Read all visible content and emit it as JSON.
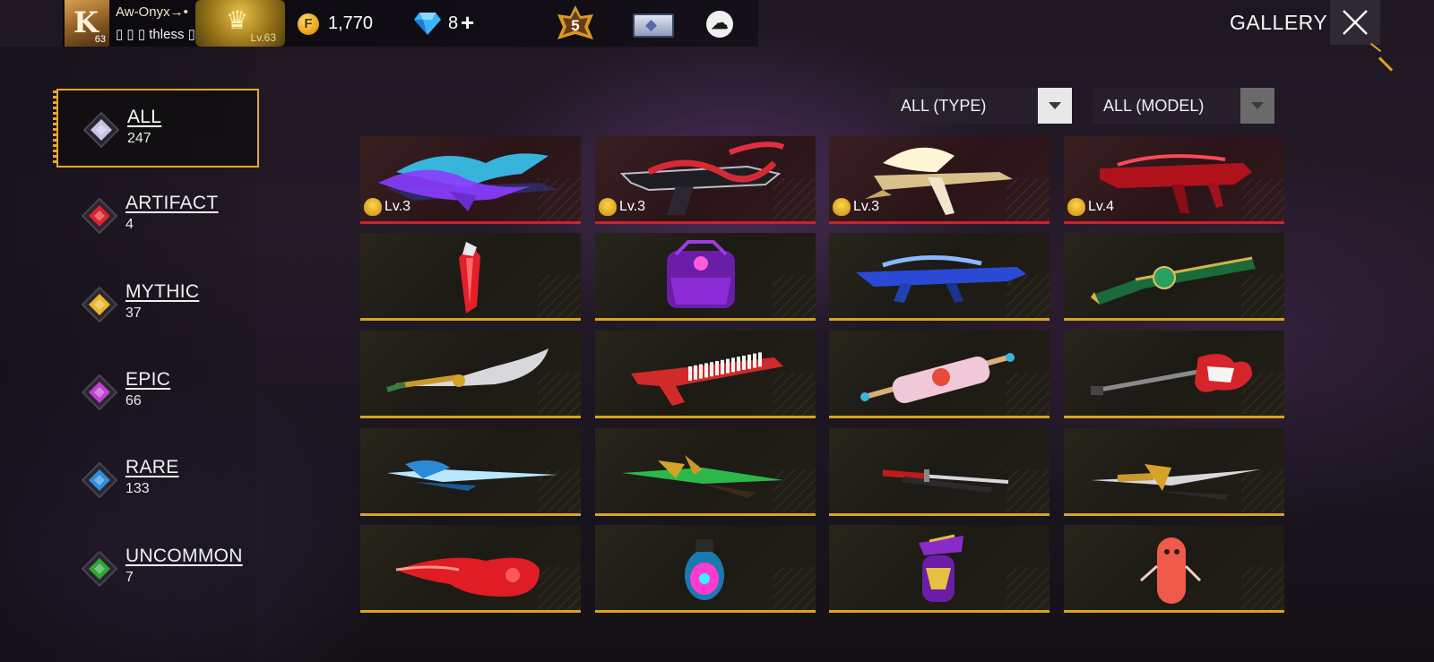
{
  "player": {
    "name": "Aw-Onyx→•",
    "guild": "▯ ▯ ▯ thless ▯",
    "avatar_letter": "K",
    "avatar_level": "63",
    "badge_level": "Lv.63"
  },
  "currency": {
    "coin_icon": "F",
    "gold": "1,770",
    "diamonds": "8",
    "diamond_plus": "+"
  },
  "rank_badge": "5",
  "page_title": "GALLERY",
  "categories": [
    {
      "name": "ALL",
      "count": "247",
      "color": "#c9c3e6"
    },
    {
      "name": "ARTIFACT",
      "count": "4",
      "color": "#d9222c"
    },
    {
      "name": "MYTHIC",
      "count": "37",
      "color": "#e9b62a"
    },
    {
      "name": "EPIC",
      "count": "66",
      "color": "#c33fd1"
    },
    {
      "name": "RARE",
      "count": "133",
      "color": "#2d8fd6"
    },
    {
      "name": "UNCOMMON",
      "count": "7",
      "color": "#2fa53a"
    }
  ],
  "filters": {
    "type": "ALL (TYPE)",
    "model": "ALL (MODEL)"
  },
  "items": [
    {
      "rarity": "artifact",
      "level": "Lv.3",
      "icon": "dragon-rifle"
    },
    {
      "rarity": "artifact",
      "level": "Lv.3",
      "icon": "serpent-rifle"
    },
    {
      "rarity": "artifact",
      "level": "Lv.3",
      "icon": "winged-rifle"
    },
    {
      "rarity": "artifact",
      "level": "Lv.4",
      "icon": "crimson-smg"
    },
    {
      "rarity": "mythic",
      "icon": "red-crystal"
    },
    {
      "rarity": "mythic",
      "icon": "purple-backpack"
    },
    {
      "rarity": "mythic",
      "icon": "blue-rifle"
    },
    {
      "rarity": "mythic",
      "icon": "jade-shotgun"
    },
    {
      "rarity": "mythic",
      "icon": "golden-scimitar"
    },
    {
      "rarity": "mythic",
      "icon": "keytar"
    },
    {
      "rarity": "mythic",
      "icon": "rolling-pin"
    },
    {
      "rarity": "mythic",
      "icon": "electric-guitar"
    },
    {
      "rarity": "mythic",
      "icon": "ice-katana"
    },
    {
      "rarity": "mythic",
      "icon": "jade-blade"
    },
    {
      "rarity": "mythic",
      "icon": "red-katana"
    },
    {
      "rarity": "mythic",
      "icon": "golden-katana"
    },
    {
      "rarity": "mythic",
      "icon": "red-flame-fist"
    },
    {
      "rarity": "mythic",
      "icon": "neon-grenade"
    },
    {
      "rarity": "mythic",
      "icon": "purple-grenade"
    },
    {
      "rarity": "mythic",
      "icon": "sausage-grenade"
    }
  ]
}
